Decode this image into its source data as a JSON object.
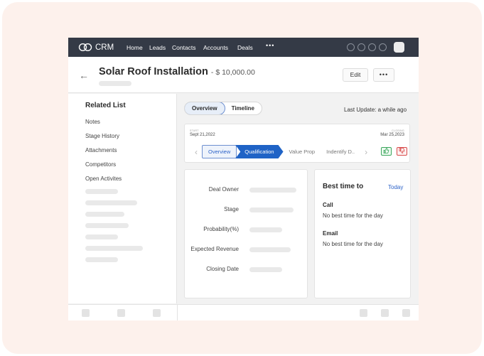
{
  "nav": {
    "logo_text": "CRM",
    "items": [
      "Home",
      "Leads",
      "Contacts",
      "Accounts",
      "Deals"
    ],
    "more": "•••"
  },
  "header": {
    "back_icon": "←",
    "title": "Solar Roof Installation",
    "amount": "- $ 10,000.00",
    "edit_label": "Edit",
    "more_label": "•••"
  },
  "related": {
    "title": "Related List",
    "items": [
      "Notes",
      "Stage History",
      "Attachments",
      "Competitors",
      "Open Activites"
    ]
  },
  "tabs": {
    "overview": "Overview",
    "timeline": "Timeline"
  },
  "last_update": "Last Update: a while ago",
  "stage": {
    "start_caption": "START",
    "start_date": "Sept 21,2022",
    "close_caption": "CLOSING",
    "close_date": "Mar 25,2023",
    "prev_icon": "‹",
    "next_icon": "›",
    "segments": [
      "Overview",
      "Qualification",
      "Value Prop",
      "Indentify D.."
    ],
    "thumb_up_icon": "👍",
    "thumb_down_icon": "👎"
  },
  "deal_fields": [
    "Deal Owner",
    "Stage",
    "Probability(%)",
    "Expected Revenue",
    "Closing Date"
  ],
  "best_time": {
    "title": "Best time to",
    "today": "Today",
    "call_label": "Call",
    "call_value": "No best time for the day",
    "email_label": "Email",
    "email_value": "No best time for the day"
  }
}
